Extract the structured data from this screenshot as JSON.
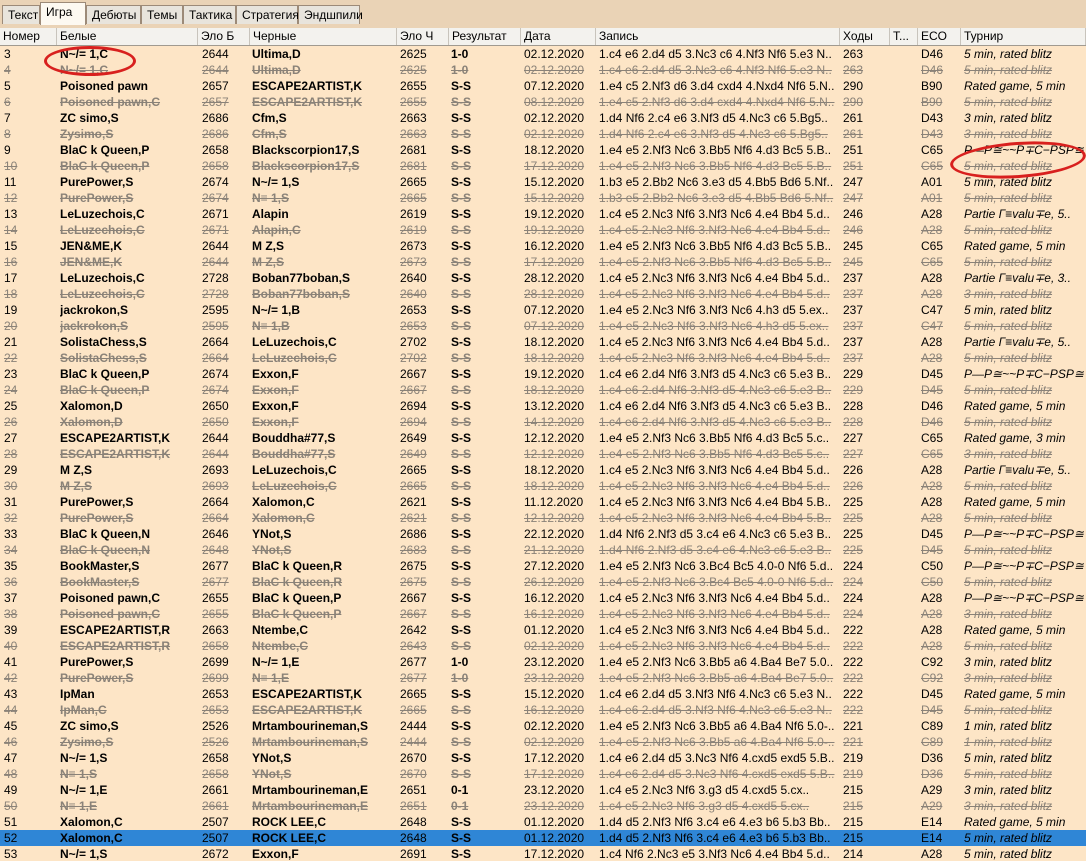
{
  "tabs": [
    "Текст",
    "Игра",
    "Дебюты",
    "Темы",
    "Тактика",
    "Стратегия",
    "Эндшпили"
  ],
  "active_tab": "Игра",
  "columns": {
    "num": "Номер",
    "white": "Белые",
    "elo_white": "Эло Б",
    "black": "Черные",
    "elo_black": "Эло Ч",
    "result": "Результат",
    "date": "Дата",
    "moves": "Запись",
    "move_count": "Ходы",
    "t": "Т...",
    "eco": "ECO",
    "tournament": "Турнир"
  },
  "rows": [
    [
      "3",
      "N~/= 1,C",
      "2644",
      "Ultima,D",
      "2625",
      "1-0",
      "02.12.2020",
      "1.c4 e6 2.d4 d5 3.Nc3 c6 4.Nf3 Nf6 5.e3 N..",
      "263",
      "",
      "D46",
      "5 min, rated blitz"
    ],
    [
      "4",
      "N~/= 1,C",
      "2644",
      "Ultima,D",
      "2625",
      "1-0",
      "02.12.2020",
      "1.c4 e6 2.d4 d5 3.Nc3 c6 4.Nf3 Nf6 5.e3 N..",
      "263",
      "",
      "D46",
      "5 min, rated blitz"
    ],
    [
      "5",
      "Poisoned pawn",
      "2657",
      "ESCAPE2ARTIST,K",
      "2655",
      "S-S",
      "07.12.2020",
      "1.e4 c5 2.Nf3 d6 3.d4 cxd4 4.Nxd4 Nf6 5.N..",
      "290",
      "",
      "B90",
      "Rated game, 5 min"
    ],
    [
      "6",
      "Poisoned pawn,C",
      "2657",
      "ESCAPE2ARTIST,K",
      "2655",
      "S-S",
      "08.12.2020",
      "1.e4 c5 2.Nf3 d6 3.d4 cxd4 4.Nxd4 Nf6 5.N..",
      "290",
      "",
      "B90",
      "5 min, rated blitz"
    ],
    [
      "7",
      "ZC simo,S",
      "2686",
      "Cfm,S",
      "2663",
      "S-S",
      "02.12.2020",
      "1.d4 Nf6 2.c4 e6 3.Nf3 d5 4.Nc3 c6 5.Bg5..",
      "261",
      "",
      "D43",
      "3 min, rated blitz"
    ],
    [
      "8",
      "Zysimo,S",
      "2686",
      "Cfm,S",
      "2663",
      "S-S",
      "02.12.2020",
      "1.d4 Nf6 2.c4 e6 3.Nf3 d5 4.Nc3 c6 5.Bg5..",
      "261",
      "",
      "D43",
      "3 min, rated blitz"
    ],
    [
      "9",
      "BlaC k Queen,P",
      "2658",
      "Blackscorpion17,S",
      "2681",
      "S-S",
      "18.12.2020",
      "1.e4 e5 2.Nf3 Nc6 3.Bb5 Nf6 4.d3 Bc5 5.B..",
      "251",
      "",
      "C65",
      "P—P≅~~P∓C−PSP≅"
    ],
    [
      "10",
      "BlaC k Queen,P",
      "2658",
      "Blackscorpion17,S",
      "2681",
      "S-S",
      "17.12.2020",
      "1.e4 e5 2.Nf3 Nc6 3.Bb5 Nf6 4.d3 Bc5 5.B..",
      "251",
      "",
      "C65",
      "5 min, rated blitz"
    ],
    [
      "11",
      "PurePower,S",
      "2674",
      "N~/= 1,S",
      "2665",
      "S-S",
      "15.12.2020",
      "1.b3 e5 2.Bb2 Nc6 3.e3 d5 4.Bb5 Bd6 5.Nf..",
      "247",
      "",
      "A01",
      "5 min, rated blitz"
    ],
    [
      "12",
      "PurePower,S",
      "2674",
      "N≡ 1,S",
      "2665",
      "S-S",
      "15.12.2020",
      "1.b3 e5 2.Bb2 Nc6 3.e3 d5 4.Bb5 Bd6 5.Nf..",
      "247",
      "",
      "A01",
      "5 min, rated blitz"
    ],
    [
      "13",
      "LeLuzechois,C",
      "2671",
      "Alapin",
      "2619",
      "S-S",
      "19.12.2020",
      "1.c4 e5 2.Nc3 Nf6 3.Nf3 Nc6 4.e4 Bb4 5.d..",
      "246",
      "",
      "A28",
      "Partie Г≡valu∓e, 5.."
    ],
    [
      "14",
      "LeLuzechois,C",
      "2671",
      "Alapin,C",
      "2619",
      "S-S",
      "19.12.2020",
      "1.c4 e5 2.Nc3 Nf6 3.Nf3 Nc6 4.e4 Bb4 5.d..",
      "246",
      "",
      "A28",
      "5 min, rated blitz"
    ],
    [
      "15",
      "JEN&ME,K",
      "2644",
      "M Z,S",
      "2673",
      "S-S",
      "16.12.2020",
      "1.e4 e5 2.Nf3 Nc6 3.Bb5 Nf6 4.d3 Bc5 5.B..",
      "245",
      "",
      "C65",
      "Rated game, 5 min"
    ],
    [
      "16",
      "JEN&ME,K",
      "2644",
      "M Z,S",
      "2673",
      "S-S",
      "17.12.2020",
      "1.e4 e5 2.Nf3 Nc6 3.Bb5 Nf6 4.d3 Bc5 5.B..",
      "245",
      "",
      "C65",
      "5 min, rated blitz"
    ],
    [
      "17",
      "LeLuzechois,C",
      "2728",
      "Boban77boban,S",
      "2640",
      "S-S",
      "28.12.2020",
      "1.c4 e5 2.Nc3 Nf6 3.Nf3 Nc6 4.e4 Bb4 5.d..",
      "237",
      "",
      "A28",
      "Partie Г≡valu∓e, 3.."
    ],
    [
      "18",
      "LeLuzechois,C",
      "2728",
      "Boban77boban,S",
      "2640",
      "S-S",
      "28.12.2020",
      "1.c4 e5 2.Nc3 Nf6 3.Nf3 Nc6 4.e4 Bb4 5.d..",
      "237",
      "",
      "A28",
      "3 min, rated blitz"
    ],
    [
      "19",
      "jackrokon,S",
      "2595",
      "N~/= 1,B",
      "2653",
      "S-S",
      "07.12.2020",
      "1.e4 e5 2.Nc3 Nf6 3.Nf3 Nc6 4.h3 d5 5.ex..",
      "237",
      "",
      "C47",
      "5 min, rated blitz"
    ],
    [
      "20",
      "jackrokon,S",
      "2595",
      "N≡ 1,B",
      "2653",
      "S-S",
      "07.12.2020",
      "1.e4 e5 2.Nc3 Nf6 3.Nf3 Nc6 4.h3 d5 5.ex..",
      "237",
      "",
      "C47",
      "5 min, rated blitz"
    ],
    [
      "21",
      "SolistaChess,S",
      "2664",
      "LeLuzechois,C",
      "2702",
      "S-S",
      "18.12.2020",
      "1.c4 e5 2.Nc3 Nf6 3.Nf3 Nc6 4.e4 Bb4 5.d..",
      "237",
      "",
      "A28",
      "Partie Г≡valu∓e, 5.."
    ],
    [
      "22",
      "SolistaChess,S",
      "2664",
      "LeLuzechois,C",
      "2702",
      "S-S",
      "18.12.2020",
      "1.c4 e5 2.Nc3 Nf6 3.Nf3 Nc6 4.e4 Bb4 5.d..",
      "237",
      "",
      "A28",
      "5 min, rated blitz"
    ],
    [
      "23",
      "BlaC k Queen,P",
      "2674",
      "Exxon,F",
      "2667",
      "S-S",
      "19.12.2020",
      "1.c4 e6 2.d4 Nf6 3.Nf3 d5 4.Nc3 c6 5.e3 B..",
      "229",
      "",
      "D45",
      "P—P≅~~P∓C−PSP≅"
    ],
    [
      "24",
      "BlaC k Queen,P",
      "2674",
      "Exxon,F",
      "2667",
      "S-S",
      "18.12.2020",
      "1.c4 e6 2.d4 Nf6 3.Nf3 d5 4.Nc3 c6 5.e3 B..",
      "229",
      "",
      "D45",
      "5 min, rated blitz"
    ],
    [
      "25",
      "Xalomon,D",
      "2650",
      "Exxon,F",
      "2694",
      "S-S",
      "13.12.2020",
      "1.c4 e6 2.d4 Nf6 3.Nf3 d5 4.Nc3 c6 5.e3 B..",
      "228",
      "",
      "D46",
      "Rated game, 5 min"
    ],
    [
      "26",
      "Xalomon,D",
      "2650",
      "Exxon,F",
      "2694",
      "S-S",
      "14.12.2020",
      "1.c4 e6 2.d4 Nf6 3.Nf3 d5 4.Nc3 c6 5.e3 B..",
      "228",
      "",
      "D46",
      "5 min, rated blitz"
    ],
    [
      "27",
      "ESCAPE2ARTIST,K",
      "2644",
      "Bouddha#77,S",
      "2649",
      "S-S",
      "12.12.2020",
      "1.e4 e5 2.Nf3 Nc6 3.Bb5 Nf6 4.d3 Bc5 5.c..",
      "227",
      "",
      "C65",
      "Rated game, 3 min"
    ],
    [
      "28",
      "ESCAPE2ARTIST,K",
      "2644",
      "Bouddha#77,S",
      "2649",
      "S-S",
      "12.12.2020",
      "1.e4 e5 2.Nf3 Nc6 3.Bb5 Nf6 4.d3 Bc5 5.c..",
      "227",
      "",
      "C65",
      "3 min, rated blitz"
    ],
    [
      "29",
      "M Z,S",
      "2693",
      "LeLuzechois,C",
      "2665",
      "S-S",
      "18.12.2020",
      "1.c4 e5 2.Nc3 Nf6 3.Nf3 Nc6 4.e4 Bb4 5.d..",
      "226",
      "",
      "A28",
      "Partie Г≡valu∓e, 5.."
    ],
    [
      "30",
      "M Z,S",
      "2693",
      "LeLuzechois,C",
      "2665",
      "S-S",
      "18.12.2020",
      "1.c4 e5 2.Nc3 Nf6 3.Nf3 Nc6 4.e4 Bb4 5.d..",
      "226",
      "",
      "A28",
      "5 min, rated blitz"
    ],
    [
      "31",
      "PurePower,S",
      "2664",
      "Xalomon,C",
      "2621",
      "S-S",
      "11.12.2020",
      "1.c4 e5 2.Nc3 Nf6 3.Nf3 Nc6 4.e4 Bb4 5.B..",
      "225",
      "",
      "A28",
      "Rated game, 5 min"
    ],
    [
      "32",
      "PurePower,S",
      "2664",
      "Xalomon,C",
      "2621",
      "S-S",
      "12.12.2020",
      "1.c4 e5 2.Nc3 Nf6 3.Nf3 Nc6 4.e4 Bb4 5.B..",
      "225",
      "",
      "A28",
      "5 min, rated blitz"
    ],
    [
      "33",
      "BlaC k Queen,N",
      "2646",
      "YNot,S",
      "2686",
      "S-S",
      "22.12.2020",
      "1.d4 Nf6 2.Nf3 d5 3.c4 e6 4.Nc3 c6 5.e3 B..",
      "225",
      "",
      "D45",
      "P—P≅~~P∓C−PSP≅"
    ],
    [
      "34",
      "BlaC k Queen,N",
      "2648",
      "YNot,S",
      "2683",
      "S-S",
      "21.12.2020",
      "1.d4 Nf6 2.Nf3 d5 3.c4 e6 4.Nc3 c6 5.e3 B..",
      "225",
      "",
      "D45",
      "5 min, rated blitz"
    ],
    [
      "35",
      "BookMaster,S",
      "2677",
      "BlaC k Queen,R",
      "2675",
      "S-S",
      "27.12.2020",
      "1.e4 e5 2.Nf3 Nc6 3.Bc4 Bc5 4.0-0 Nf6 5.d..",
      "224",
      "",
      "C50",
      "P—P≅~~P∓C−PSP≅"
    ],
    [
      "36",
      "BookMaster,S",
      "2677",
      "BlaC k Queen,R",
      "2675",
      "S-S",
      "26.12.2020",
      "1.e4 e5 2.Nf3 Nc6 3.Bc4 Bc5 4.0-0 Nf6 5.d..",
      "224",
      "",
      "C50",
      "5 min, rated blitz"
    ],
    [
      "37",
      "Poisoned pawn,C",
      "2655",
      "BlaC k Queen,P",
      "2667",
      "S-S",
      "16.12.2020",
      "1.c4 e5 2.Nc3 Nf6 3.Nf3 Nc6 4.e4 Bb4 5.d..",
      "224",
      "",
      "A28",
      "P—P≅~~P∓C−PSP≅"
    ],
    [
      "38",
      "Poisoned pawn,C",
      "2655",
      "BlaC k Queen,P",
      "2667",
      "S-S",
      "16.12.2020",
      "1.c4 e5 2.Nc3 Nf6 3.Nf3 Nc6 4.e4 Bb4 5.d..",
      "224",
      "",
      "A28",
      "3 min, rated blitz"
    ],
    [
      "39",
      "ESCAPE2ARTIST,R",
      "2663",
      "Ntembe,C",
      "2642",
      "S-S",
      "01.12.2020",
      "1.c4 e5 2.Nc3 Nf6 3.Nf3 Nc6 4.e4 Bb4 5.d..",
      "222",
      "",
      "A28",
      "Rated game, 5 min"
    ],
    [
      "40",
      "ESCAPE2ARTIST,R",
      "2658",
      "Ntembe,C",
      "2643",
      "S-S",
      "02.12.2020",
      "1.c4 e5 2.Nc3 Nf6 3.Nf3 Nc6 4.e4 Bb4 5.d..",
      "222",
      "",
      "A28",
      "5 min, rated blitz"
    ],
    [
      "41",
      "PurePower,S",
      "2699",
      "N~/= 1,E",
      "2677",
      "1-0",
      "23.12.2020",
      "1.e4 e5 2.Nf3 Nc6 3.Bb5 a6 4.Ba4 Be7 5.0..",
      "222",
      "",
      "C92",
      "3 min, rated blitz"
    ],
    [
      "42",
      "PurePower,S",
      "2699",
      "N≡ 1,E",
      "2677",
      "1-0",
      "23.12.2020",
      "1.e4 e5 2.Nf3 Nc6 3.Bb5 a6 4.Ba4 Be7 5.0..",
      "222",
      "",
      "C92",
      "3 min, rated blitz"
    ],
    [
      "43",
      "IpMan",
      "2653",
      "ESCAPE2ARTIST,K",
      "2665",
      "S-S",
      "15.12.2020",
      "1.c4 e6 2.d4 d5 3.Nf3 Nf6 4.Nc3 c6 5.e3 N..",
      "222",
      "",
      "D45",
      "Rated game, 5 min"
    ],
    [
      "44",
      "IpMan,C",
      "2653",
      "ESCAPE2ARTIST,K",
      "2665",
      "S-S",
      "16.12.2020",
      "1.c4 e6 2.d4 d5 3.Nf3 Nf6 4.Nc3 c6 5.e3 N..",
      "222",
      "",
      "D45",
      "5 min, rated blitz"
    ],
    [
      "45",
      "ZC simo,S",
      "2526",
      "Mrtambourineman,S",
      "2444",
      "S-S",
      "02.12.2020",
      "1.e4 e5 2.Nf3 Nc6 3.Bb5 a6 4.Ba4 Nf6 5.0-..",
      "221",
      "",
      "C89",
      "1 min, rated blitz"
    ],
    [
      "46",
      "Zysimo,S",
      "2526",
      "Mrtambourineman,S",
      "2444",
      "S-S",
      "02.12.2020",
      "1.e4 e5 2.Nf3 Nc6 3.Bb5 a6 4.Ba4 Nf6 5.0-..",
      "221",
      "",
      "C89",
      "1 min, rated blitz"
    ],
    [
      "47",
      "N~/= 1,S",
      "2658",
      "YNot,S",
      "2670",
      "S-S",
      "17.12.2020",
      "1.c4 e6 2.d4 d5 3.Nc3 Nf6 4.cxd5 exd5 5.B..",
      "219",
      "",
      "D36",
      "5 min, rated blitz"
    ],
    [
      "48",
      "N≡ 1,S",
      "2658",
      "YNot,S",
      "2670",
      "S-S",
      "17.12.2020",
      "1.c4 e6 2.d4 d5 3.Nc3 Nf6 4.cxd5 exd5 5.B..",
      "219",
      "",
      "D36",
      "5 min, rated blitz"
    ],
    [
      "49",
      "N~/= 1,E",
      "2661",
      "Mrtambourineman,E",
      "2651",
      "0-1",
      "23.12.2020",
      "1.c4 e5 2.Nc3 Nf6 3.g3 d5 4.cxd5 5.cx..",
      "215",
      "",
      "A29",
      "3 min, rated blitz"
    ],
    [
      "50",
      "N≡ 1,E",
      "2661",
      "Mrtambourineman,E",
      "2651",
      "0-1",
      "23.12.2020",
      "1.c4 e5 2.Nc3 Nf6 3.g3 d5 4.cxd5 5.cx..",
      "215",
      "",
      "A29",
      "3 min, rated blitz"
    ],
    [
      "51",
      "Xalomon,C",
      "2507",
      "ROCK LEE,C",
      "2648",
      "S-S",
      "01.12.2020",
      "1.d4 d5 2.Nf3 Nf6 3.c4 e6 4.e3 b6 5.b3 Bb..",
      "215",
      "",
      "E14",
      "Rated game, 5 min"
    ],
    [
      "52",
      "Xalomon,C",
      "2507",
      "ROCK LEE,C",
      "2648",
      "S-S",
      "01.12.2020",
      "1.d4 d5 2.Nf3 Nf6 3.c4 e6 4.e3 b6 5.b3 Bb..",
      "215",
      "",
      "E14",
      "5 min, rated blitz"
    ],
    [
      "53",
      "N~/= 1,S",
      "2672",
      "Exxon,F",
      "2691",
      "S-S",
      "17.12.2020",
      "1.c4 Nf6 2.Nc3 e5 3.Nf3 Nc6 4.e4 Bb4 5.d..",
      "214",
      "",
      "A28",
      "5 min, rated blitz"
    ]
  ],
  "ghost_rows": [
    4,
    6,
    8,
    10,
    12,
    14,
    16,
    18,
    20,
    22,
    24,
    26,
    28,
    30,
    32,
    34,
    36,
    38,
    40,
    42,
    44,
    46,
    48,
    50
  ],
  "selected_row": 52,
  "colors": {
    "background": "#fde5c6",
    "text": "#000000",
    "ghost_text": "#8a8278",
    "selection": "#2f86d6",
    "annotation": "#d8201e"
  }
}
